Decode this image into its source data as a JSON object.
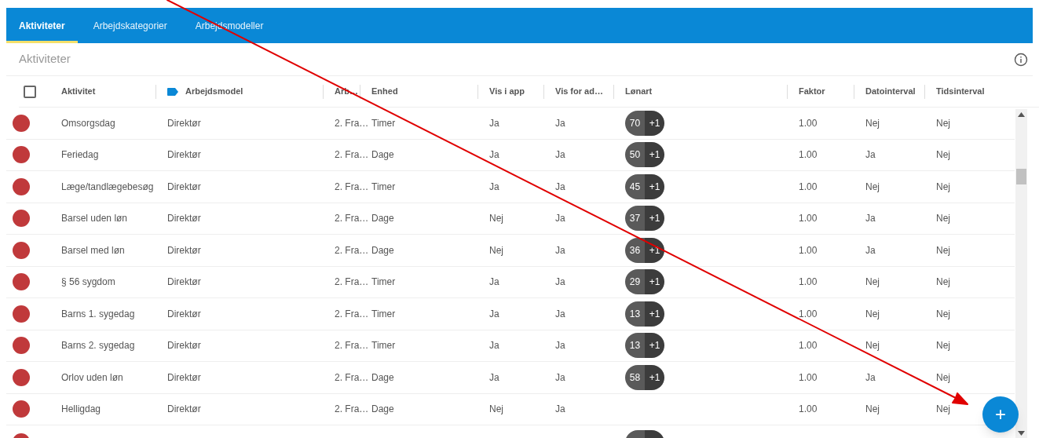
{
  "tabs": [
    {
      "label": "Aktiviteter",
      "selected": true
    },
    {
      "label": "Arbejdskategorier",
      "selected": false
    },
    {
      "label": "Arbejdsmodeller",
      "selected": false
    }
  ],
  "page_title": "Aktiviteter",
  "table": {
    "select_all": {
      "checked": false
    },
    "columns": [
      "Aktivitet",
      "Arbejdsmodel",
      "Arb…",
      "Enhed",
      "Vis i app",
      "Vis for ad…",
      "Lønart",
      "Faktor",
      "Datointerval",
      "Tidsinterval"
    ],
    "rows": [
      {
        "cells": [
          "Omsorgsdag",
          "Direktør",
          "2. Fra…",
          "Timer",
          "Ja",
          "Ja"
        ],
        "loenart": {
          "code": "70",
          "extra": "+1"
        },
        "cells_after": [
          "1.00",
          "Nej",
          "Nej"
        ]
      },
      {
        "cells": [
          "Feriedag",
          "Direktør",
          "2. Fra…",
          "Dage",
          "Ja",
          "Ja"
        ],
        "loenart": {
          "code": "50",
          "extra": "+1"
        },
        "cells_after": [
          "1.00",
          "Ja",
          "Nej"
        ]
      },
      {
        "cells": [
          "Læge/tandlægebesøg",
          "Direktør",
          "2. Fra…",
          "Timer",
          "Ja",
          "Ja"
        ],
        "loenart": {
          "code": "45",
          "extra": "+1"
        },
        "cells_after": [
          "1.00",
          "Nej",
          "Nej"
        ]
      },
      {
        "cells": [
          "Barsel uden løn",
          "Direktør",
          "2. Fra…",
          "Dage",
          "Nej",
          "Ja"
        ],
        "loenart": {
          "code": "37",
          "extra": "+1"
        },
        "cells_after": [
          "1.00",
          "Ja",
          "Nej"
        ]
      },
      {
        "cells": [
          "Barsel med løn",
          "Direktør",
          "2. Fra…",
          "Dage",
          "Nej",
          "Ja"
        ],
        "loenart": {
          "code": "36",
          "extra": "+1"
        },
        "cells_after": [
          "1.00",
          "Ja",
          "Nej"
        ]
      },
      {
        "cells": [
          "§ 56 sygdom",
          "Direktør",
          "2. Fra…",
          "Timer",
          "Ja",
          "Ja"
        ],
        "loenart": {
          "code": "29",
          "extra": "+1"
        },
        "cells_after": [
          "1.00",
          "Nej",
          "Nej"
        ]
      },
      {
        "cells": [
          "Barns 1. sygedag",
          "Direktør",
          "2. Fra…",
          "Timer",
          "Ja",
          "Ja"
        ],
        "loenart": {
          "code": "13",
          "extra": "+1"
        },
        "cells_after": [
          "1.00",
          "Nej",
          "Nej"
        ]
      },
      {
        "cells": [
          "Barns 2. sygedag",
          "Direktør",
          "2. Fra…",
          "Timer",
          "Ja",
          "Ja"
        ],
        "loenart": {
          "code": "13",
          "extra": "+1"
        },
        "cells_after": [
          "1.00",
          "Nej",
          "Nej"
        ]
      },
      {
        "cells": [
          "Orlov uden løn",
          "Direktør",
          "2. Fra…",
          "Dage",
          "Ja",
          "Ja"
        ],
        "loenart": {
          "code": "58",
          "extra": "+1"
        },
        "cells_after": [
          "1.00",
          "Ja",
          "Nej"
        ]
      },
      {
        "cells": [
          "Helligdag",
          "Direktør",
          "2. Fra…",
          "Dage",
          "Nej",
          "Ja"
        ],
        "cells_after": [
          "1.00",
          "Nej",
          "Nej"
        ]
      }
    ]
  },
  "fab": {
    "label": "+"
  }
}
